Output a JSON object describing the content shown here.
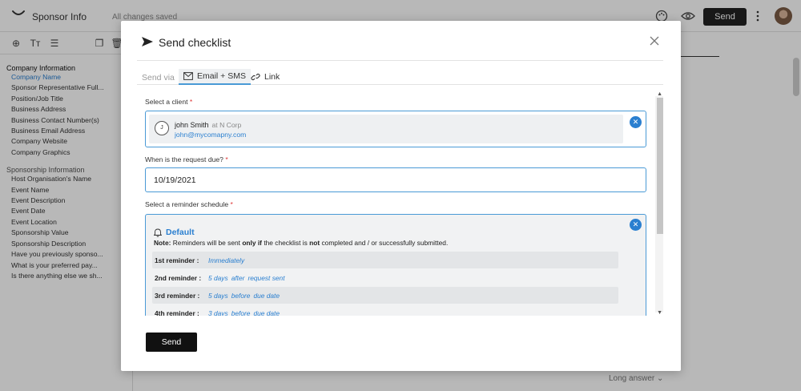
{
  "app": {
    "title": "Sponsor Info",
    "saved_status": "All changes saved",
    "send_label": "Send",
    "long_answer": "Long answer"
  },
  "sidebar": {
    "sections": [
      {
        "title": "Company Information",
        "items": [
          "Company Name",
          "Sponsor Representative Full...",
          "Position/Job Title",
          "Business Address",
          "Business Contact Number(s)",
          "Business Email Address",
          "Company Website",
          "Company Graphics"
        ]
      },
      {
        "title": "Sponsorship Information",
        "items": [
          "Host Organisation's Name",
          "Event Name",
          "Event Description",
          "Event Date",
          "Event Location",
          "Sponsorship Value",
          "Sponsorship Description",
          "Have you previously sponso...",
          "What is your preferred pay...",
          "Is there anything else we sh..."
        ]
      }
    ],
    "active_item": "Company Name"
  },
  "modal": {
    "title": "Send checklist",
    "send_via_label": "Send via",
    "tabs": [
      "Email + SMS",
      "Link"
    ],
    "active_tab": "Email + SMS",
    "client_label": "Select a client",
    "required_mark": "*",
    "client": {
      "initial": "J",
      "name": "john Smith",
      "company": "at N Corp",
      "email": "john@mycomapny.com"
    },
    "due_label": "When is the request due?",
    "due_value": "10/19/2021",
    "reminder_label": "Select a reminder schedule",
    "schedule": {
      "title": "Default",
      "note_prefix": "Note:",
      "note_1": "Reminders will be sent",
      "note_only_if": "only if",
      "note_2": "the checklist is",
      "note_not": "not",
      "note_3": "completed and / or successfully submitted.",
      "reminders": [
        {
          "name": "1st reminder :",
          "parts": [
            "Immediately"
          ]
        },
        {
          "name": "2nd reminder :",
          "parts": [
            "5 days",
            "after",
            "request sent"
          ]
        },
        {
          "name": "3rd reminder :",
          "parts": [
            "5 days",
            "before",
            "due date"
          ]
        },
        {
          "name": "4th reminder :",
          "parts": [
            "3 days",
            "before",
            "due date"
          ]
        }
      ]
    },
    "send_label": "Send"
  },
  "colors": {
    "accent": "#2a7fd0",
    "dark_button": "#111111",
    "overlay": "rgba(0,0,0,0.28)"
  },
  "icons": {
    "logo": "smile-logo-icon",
    "palette": "palette-icon",
    "preview": "eye-icon",
    "more": "more-vertical-icon",
    "title": "paper-plane-icon",
    "close": "close-icon",
    "email": "envelope-icon",
    "link": "link-icon",
    "bell": "bell-icon"
  }
}
